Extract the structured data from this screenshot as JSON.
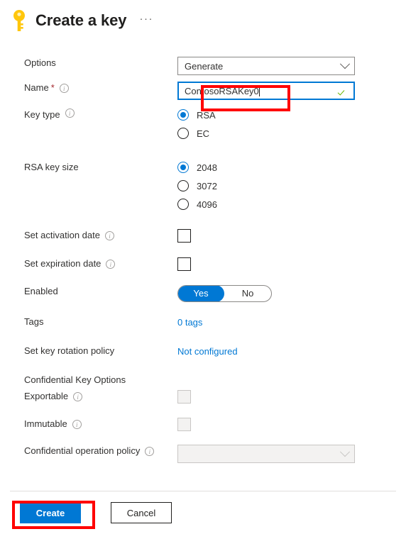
{
  "header": {
    "icon": "key-icon",
    "title": "Create a key",
    "more_menu": "···"
  },
  "form": {
    "options": {
      "label": "Options",
      "value": "Generate",
      "chevron": "chevron-down-icon"
    },
    "name": {
      "label": "Name",
      "required_marker": "*",
      "info": "i",
      "value": "ContosoRSAKey0",
      "validation": "valid-check-icon"
    },
    "key_type": {
      "label": "Key type",
      "info": "i",
      "options": [
        {
          "label": "RSA",
          "selected": true
        },
        {
          "label": "EC",
          "selected": false
        }
      ]
    },
    "rsa_key_size": {
      "label": "RSA key size",
      "options": [
        {
          "label": "2048",
          "selected": true
        },
        {
          "label": "3072",
          "selected": false
        },
        {
          "label": "4096",
          "selected": false
        }
      ]
    },
    "set_activation_date": {
      "label": "Set activation date",
      "info": "i",
      "checked": false
    },
    "set_expiration_date": {
      "label": "Set expiration date",
      "info": "i",
      "checked": false
    },
    "enabled": {
      "label": "Enabled",
      "yes_label": "Yes",
      "no_label": "No",
      "value": "Yes"
    },
    "tags": {
      "label": "Tags",
      "value": "0 tags"
    },
    "key_rotation_policy": {
      "label": "Set key rotation policy",
      "value": "Not configured"
    },
    "confidential_key_options": {
      "heading": "Confidential Key Options",
      "exportable": {
        "label": "Exportable",
        "info": "i",
        "checked": false,
        "disabled": true
      },
      "immutable": {
        "label": "Immutable",
        "info": "i",
        "checked": false,
        "disabled": true
      },
      "confidential_operation_policy": {
        "label": "Confidential operation policy",
        "info": "i",
        "value": "",
        "disabled": true,
        "chevron": "chevron-down-icon"
      }
    }
  },
  "footer": {
    "create_label": "Create",
    "cancel_label": "Cancel"
  },
  "colors": {
    "accent": "#0078d4",
    "annotation": "#ff0000",
    "required": "#a4262c",
    "valid": "#6bb700",
    "key_icon": "#ffc107"
  }
}
